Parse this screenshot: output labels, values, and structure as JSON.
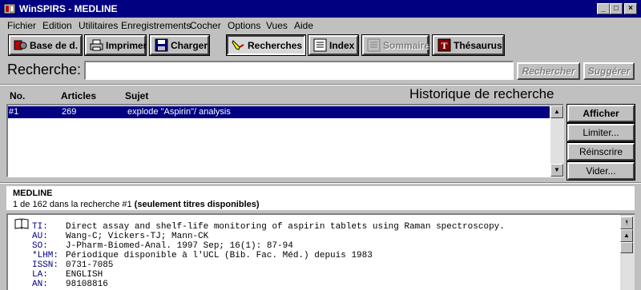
{
  "window": {
    "title": "WinSPIRS - MEDLINE",
    "minimize": "_",
    "maximize": "□",
    "close": "×"
  },
  "menu": [
    "Fichier",
    "Edition",
    "Utilitaires",
    "Enregistrements",
    "Cocher",
    "Options",
    "Vues",
    "Aide"
  ],
  "toolbar": {
    "database": "Base de d.",
    "print": "Imprimer",
    "load": "Charger",
    "searches": "Recherches",
    "index": "Index",
    "summary": "Sommaire",
    "thesaurus": "Thésaurus"
  },
  "search": {
    "label": "Recherche:",
    "value": "",
    "search_button": "Rechercher",
    "suggest_button": "Suggérer"
  },
  "history": {
    "title": "Historique de recherche",
    "columns": {
      "no": "No.",
      "articles": "Articles",
      "subject": "Sujet"
    },
    "rows": [
      {
        "no": "#1",
        "articles": "269",
        "subject": "explode \"Aspirin\"/ analysis"
      }
    ],
    "buttons": {
      "show": "Afficher",
      "limit": "Limiter...",
      "reenter": "Réinscrire",
      "clear": "Vider..."
    }
  },
  "results": {
    "database": "MEDLINE",
    "info_prefix": "1 de 162 dans la recherche #1",
    "info_bold": "(seulement titres disponibles)"
  },
  "record": [
    {
      "label": "TI:",
      "value": "Direct assay and shelf-life monitoring of aspirin tablets using Raman spectroscopy."
    },
    {
      "label": "AU:",
      "value": "Wang-C; Vickers-TJ; Mann-CK"
    },
    {
      "label": "SO:",
      "value": "J-Pharm-Biomed-Anal. 1997 Sep; 16(1): 87-94"
    },
    {
      "label": "*LHM:",
      "value": "Périodique disponible à l'UCL (Bib. Fac. Méd.) depuis 1983"
    },
    {
      "label": "ISSN:",
      "value": "0731-7085"
    },
    {
      "label": "LA:",
      "value": "ENGLISH"
    },
    {
      "label": "AN:",
      "value": "98108816"
    }
  ]
}
